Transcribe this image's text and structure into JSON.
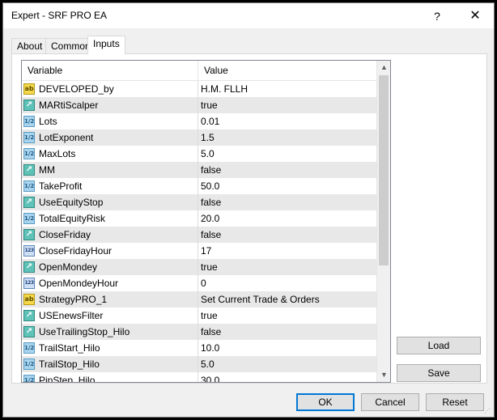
{
  "window": {
    "title": "Expert - SRF PRO EA",
    "help_glyph": "?",
    "close_glyph": "✕"
  },
  "tabs": [
    {
      "label": "About",
      "active": false
    },
    {
      "label": "Common",
      "active": false
    },
    {
      "label": "Inputs",
      "active": true
    }
  ],
  "grid": {
    "columns": {
      "variable": "Variable",
      "value": "Value"
    },
    "rows": [
      {
        "type": "string",
        "icon": "ab",
        "variable": "DEVELOPED_by",
        "value": "H.M. FLLH"
      },
      {
        "type": "bool",
        "icon": "bool",
        "variable": "MARtiScalper",
        "value": "true"
      },
      {
        "type": "double",
        "icon": "dbl",
        "variable": "Lots",
        "value": "0.01"
      },
      {
        "type": "double",
        "icon": "dbl",
        "variable": "LotExponent",
        "value": "1.5"
      },
      {
        "type": "double",
        "icon": "dbl",
        "variable": "MaxLots",
        "value": "5.0"
      },
      {
        "type": "bool",
        "icon": "bool",
        "variable": "MM",
        "value": "false"
      },
      {
        "type": "double",
        "icon": "dbl",
        "variable": "TakeProfit",
        "value": "50.0"
      },
      {
        "type": "bool",
        "icon": "bool",
        "variable": "UseEquityStop",
        "value": "false"
      },
      {
        "type": "double",
        "icon": "dbl",
        "variable": "TotalEquityRisk",
        "value": "20.0"
      },
      {
        "type": "bool",
        "icon": "bool",
        "variable": "CloseFriday",
        "value": "false"
      },
      {
        "type": "int",
        "icon": "int",
        "variable": "CloseFridayHour",
        "value": "17"
      },
      {
        "type": "bool",
        "icon": "bool",
        "variable": "OpenMondey",
        "value": "true"
      },
      {
        "type": "int",
        "icon": "int",
        "variable": "OpenMondeyHour",
        "value": "0"
      },
      {
        "type": "string",
        "icon": "ab",
        "variable": "StrategyPRO_1",
        "value": "Set Current Trade & Orders"
      },
      {
        "type": "bool",
        "icon": "bool",
        "variable": "USEnewsFilter",
        "value": "true"
      },
      {
        "type": "bool",
        "icon": "bool",
        "variable": "UseTrailingStop_Hilo",
        "value": "false"
      },
      {
        "type": "double",
        "icon": "dbl",
        "variable": "TrailStart_Hilo",
        "value": "10.0"
      },
      {
        "type": "double",
        "icon": "dbl",
        "variable": "TrailStop_Hilo",
        "value": "5.0"
      },
      {
        "type": "double",
        "icon": "dbl",
        "variable": "PipStep_Hilo",
        "value": "30.0"
      }
    ],
    "scroll_up_glyph": "▲",
    "scroll_down_glyph": "▼"
  },
  "icons": {
    "ab": "ab",
    "bool": "↗",
    "dbl": "1/2",
    "int": "123"
  },
  "side_buttons": {
    "load": "Load",
    "save": "Save"
  },
  "footer": {
    "ok": "OK",
    "cancel": "Cancel",
    "reset": "Reset"
  },
  "colors": {
    "ok_focus_border": "#0078d7",
    "row_alt": "#e8e8e8"
  }
}
